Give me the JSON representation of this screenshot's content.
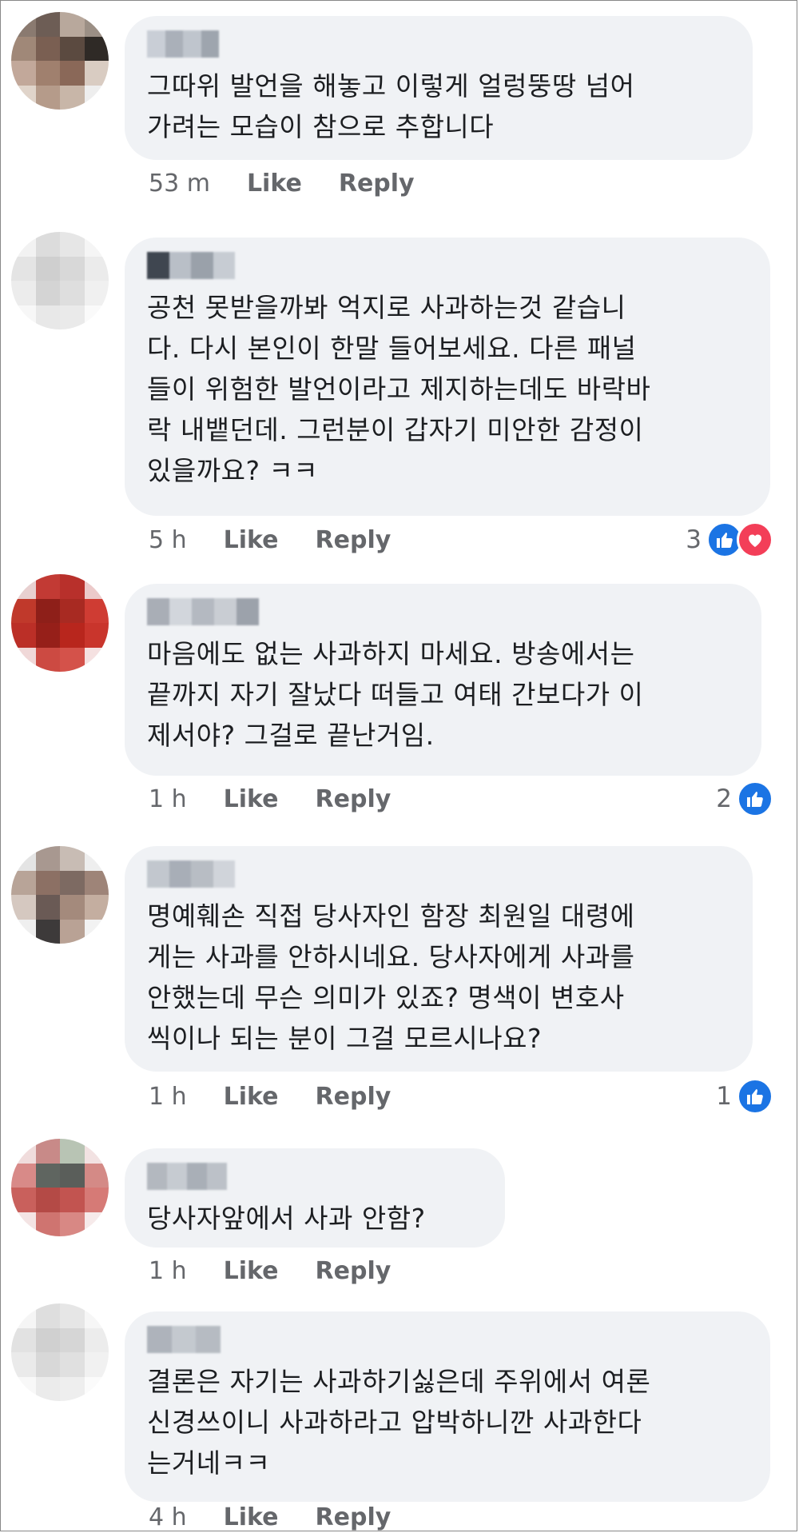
{
  "comments": [
    {
      "text": "그따위 발언을 해놓고 이렇게 얼렁뚱땅 넘어\n가려는 모습이 참으로 추합니다",
      "time": "53 m",
      "like": "Like",
      "reply": "Reply",
      "reaction_count": null
    },
    {
      "text": "공천 못받을까봐 억지로 사과하는것 같습니\n다. 다시 본인이 한말 들어보세요. 다른 패널\n들이 위험한 발언이라고 제지하는데도 바락바\n락 내뱉던데. 그런분이 갑자기 미안한 감정이\n있을까요? ㅋㅋ",
      "time": "5 h",
      "like": "Like",
      "reply": "Reply",
      "reaction_count": "3"
    },
    {
      "text": "마음에도 없는 사과하지 마세요. 방송에서는\n끝까지 자기 잘났다 떠들고 여태 간보다가 이\n제서야? 그걸로 끝난거임.",
      "time": "1 h",
      "like": "Like",
      "reply": "Reply",
      "reaction_count": "2"
    },
    {
      "text": "명예훼손 직접 당사자인 함장 최원일 대령에\n게는 사과를 안하시네요. 당사자에게 사과를\n안했는데 무슨 의미가 있죠? 명색이 변호사\n씩이나 되는 분이 그걸 모르시나요?",
      "time": "1 h",
      "like": "Like",
      "reply": "Reply",
      "reaction_count": "1"
    },
    {
      "text": "당사자앞에서 사과 안함?",
      "time": "1 h",
      "like": "Like",
      "reply": "Reply",
      "reaction_count": null
    },
    {
      "text": "결론은 자기는 사과하기싫은데 주위에서 여론\n신경쓰이니 사과하라고 압박하니깐 사과한다\n는거네ㅋㅋ",
      "time": "4 h",
      "like": "Like",
      "reply": "Reply",
      "reaction_count": null
    }
  ],
  "icons": {
    "like_reaction": "thumbs-up-icon",
    "love_reaction": "heart-icon"
  },
  "colors": {
    "bubble": "#f0f2f5",
    "like_blue": "#1b74e4",
    "love_red": "#f33e58",
    "meta_gray": "#65676b"
  }
}
